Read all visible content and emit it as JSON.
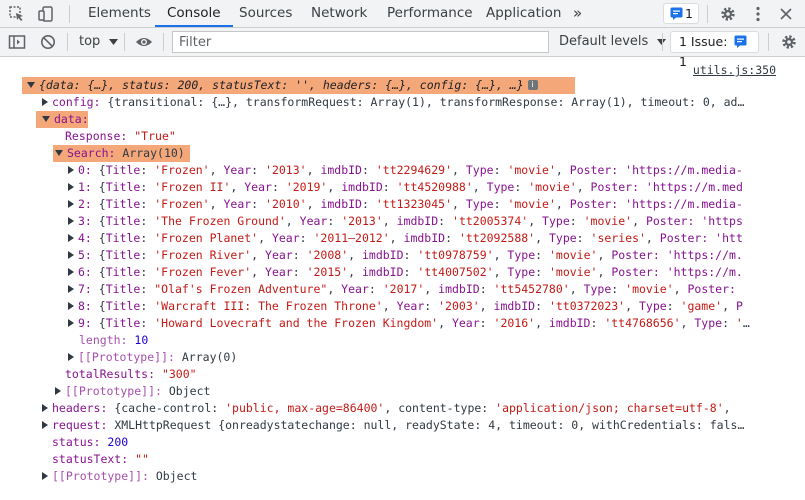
{
  "tabs": [
    "Elements",
    "Console",
    "Sources",
    "Network",
    "Performance",
    "Application"
  ],
  "more_tabs_glyph": "»",
  "issues_badge_count": "1",
  "toolbar": {
    "context": "top",
    "filter_placeholder": "Filter",
    "levels": "Default levels",
    "issues_label": "1 Issue:",
    "issues_count": "1"
  },
  "log": {
    "source_link": "utils.js:350",
    "summary": "{data: {…}, status: 200, statusText: '', headers: {…}, config: {…}, …}",
    "config_key": "config:",
    "config_val": "{transitional: {…}, transformRequest: Array(1), transformResponse: Array(1), timeout: 0, ad…",
    "data_key": "data:",
    "response_key": "Response:",
    "response_val": "\"True\"",
    "search_key": "Search:",
    "search_val": "Array(10)",
    "items": [
      {
        "idx": "0:",
        "title": "'Frozen'",
        "year": "'2013'",
        "imdb": "'tt2294629'",
        "type": "'movie'",
        "tail": "Poster: 'https://m.media-"
      },
      {
        "idx": "1:",
        "title": "'Frozen II'",
        "year": "'2019'",
        "imdb": "'tt4520988'",
        "type": "'movie'",
        "tail": "Poster: 'https://m.med"
      },
      {
        "idx": "2:",
        "title": "'Frozen'",
        "year": "'2010'",
        "imdb": "'tt1323045'",
        "type": "'movie'",
        "tail": "Poster: 'https://m.media-"
      },
      {
        "idx": "3:",
        "title": "'The Frozen Ground'",
        "year": "'2013'",
        "imdb": "'tt2005374'",
        "type": "'movie'",
        "tail": "Poster: 'https"
      },
      {
        "idx": "4:",
        "title": "'Frozen Planet'",
        "year": "'2011–2012'",
        "imdb": "'tt2092588'",
        "type": "'series'",
        "tail": "Poster: 'htt"
      },
      {
        "idx": "5:",
        "title": "'Frozen River'",
        "year": "'2008'",
        "imdb": "'tt0978759'",
        "type": "'movie'",
        "tail": "Poster: 'https://m."
      },
      {
        "idx": "6:",
        "title": "'Frozen Fever'",
        "year": "'2015'",
        "imdb": "'tt4007502'",
        "type": "'movie'",
        "tail": "Poster: 'https://m."
      },
      {
        "idx": "7:",
        "title": "\"Olaf's Frozen Adventure\"",
        "year": "'2017'",
        "imdb": "'tt5452780'",
        "type": "'movie'",
        "tail": "Poster:"
      },
      {
        "idx": "8:",
        "title": "'Warcraft III: The Frozen Throne'",
        "year": "'2003'",
        "imdb": "'tt0372023'",
        "type": "'game'",
        "tail": "P"
      },
      {
        "idx": "9:",
        "title": "'Howard Lovecraft and the Frozen Kingdom'",
        "year": "'2016'",
        "imdb": "'tt4768656'",
        "type": "'",
        "tail": ""
      }
    ],
    "length_key": "length:",
    "length_val": "10",
    "proto_array_key": "[[Prototype]]:",
    "proto_array_val": "Array(0)",
    "total_key": "totalResults:",
    "total_val": "\"300\"",
    "proto_obj_key": "[[Prototype]]:",
    "proto_obj_val": "Object",
    "headers_key": "headers:",
    "headers_val_a": "{cache-control: ",
    "headers_cc": "'public, max-age=86400'",
    "headers_val_b": ", content-type: ",
    "headers_ct": "'application/json; charset=utf-8'",
    "headers_tail": ",",
    "request_key": "request:",
    "request_val": "XMLHttpRequest {onreadystatechange: null, readyState: 4, timeout: 0, withCredentials: fals…",
    "status_key": "status:",
    "status_val": "200",
    "statustext_key": "statusText:",
    "statustext_val": "\"\"",
    "proto_root_key": "[[Prototype]]:",
    "proto_root_val": "Object"
  }
}
